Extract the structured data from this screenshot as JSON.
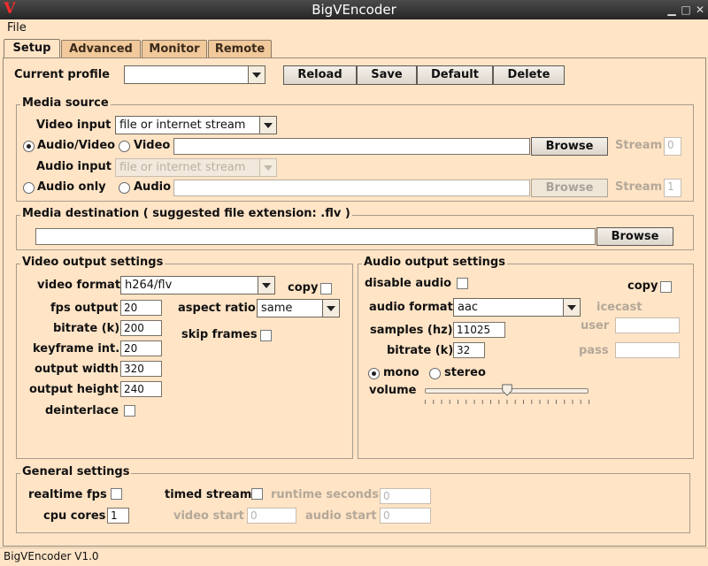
{
  "window": {
    "title": "BigVEncoder",
    "logo": "V"
  },
  "menu": {
    "file": "File"
  },
  "tabs": [
    "Setup",
    "Advanced",
    "Monitor",
    "Remote"
  ],
  "profile": {
    "label": "Current profile",
    "value": "",
    "reload": "Reload",
    "save": "Save",
    "default": "Default",
    "delete": "Delete"
  },
  "media_source": {
    "title": "Media source",
    "video_input_label": "Video input",
    "video_input_value": "file or internet stream",
    "av_radio": "Audio/Video",
    "video_radio": "Video",
    "video_path": "",
    "browse": "Browse",
    "stream_label": "Stream",
    "video_stream": "0",
    "audio_input_label": "Audio input",
    "audio_input_value": "file or internet stream",
    "audio_only_radio": "Audio only",
    "audio_radio": "Audio",
    "audio_path": "",
    "audio_stream": "1"
  },
  "media_dest": {
    "title": "Media destination ( suggested file extension: .flv )",
    "path": "",
    "browse": "Browse"
  },
  "video_out": {
    "title": "Video output settings",
    "format_label": "video format",
    "format_value": "h264/flv",
    "copy_label": "copy",
    "fps_label": "fps output",
    "fps_value": "20",
    "aspect_label": "aspect ratio",
    "aspect_value": "same",
    "bitrate_label": "bitrate (k)",
    "bitrate_value": "200",
    "skip_label": "skip frames",
    "keyframe_label": "keyframe int.",
    "keyframe_value": "20",
    "width_label": "output width",
    "width_value": "320",
    "height_label": "output height",
    "height_value": "240",
    "deinterlace_label": "deinterlace"
  },
  "audio_out": {
    "title": "Audio output settings",
    "disable_label": "disable audio",
    "copy_label": "copy",
    "format_label": "audio format",
    "format_value": "aac",
    "icecast_label": "icecast",
    "samples_label": "samples (hz)",
    "samples_value": "11025",
    "user_label": "user",
    "user_value": "",
    "bitrate_label": "bitrate (k)",
    "bitrate_value": "32",
    "pass_label": "pass",
    "pass_value": "",
    "mono_label": "mono",
    "stereo_label": "stereo",
    "volume_label": "volume",
    "volume_level": 0.5
  },
  "general": {
    "title": "General settings",
    "realtime_label": "realtime fps",
    "timed_label": "timed stream",
    "runtime_label": "runtime seconds",
    "runtime_value": "0",
    "cpu_label": "cpu cores",
    "cpu_value": "1",
    "video_start_label": "video start",
    "video_start_value": "0",
    "audio_start_label": "audio start",
    "audio_start_value": "0"
  },
  "status": {
    "text": "BigVEncoder V1.0"
  }
}
